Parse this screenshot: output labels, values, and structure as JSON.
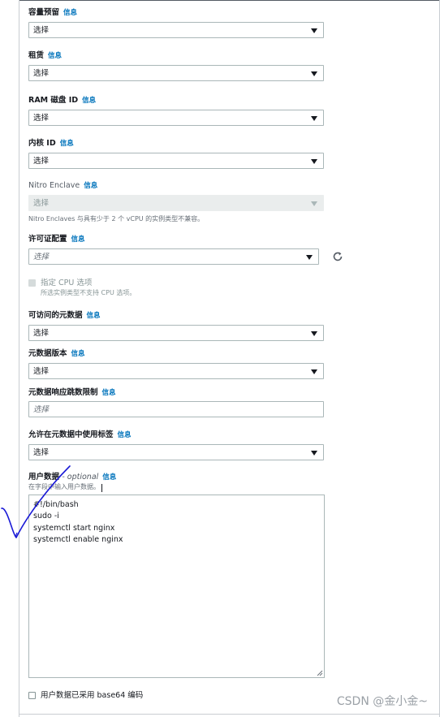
{
  "info_label": "信息",
  "fields": {
    "capacity_reservation": {
      "label": "容量预留",
      "value": "选择"
    },
    "tenancy": {
      "label": "租赁",
      "value": "选择"
    },
    "ramdisk_id": {
      "label": "RAM 磁盘 ID",
      "value": "选择"
    },
    "kernel_id": {
      "label": "内核 ID",
      "value": "选择"
    },
    "nitro_enclave": {
      "label": "Nitro Enclave",
      "value": "选择",
      "description": "Nitro Enclaves 与具有少于 2 个 vCPU 的实例类型不兼容。"
    },
    "license_config": {
      "label": "许可证配置",
      "placeholder": "选择"
    },
    "specify_cpu": {
      "label": "指定 CPU 选项",
      "description": "所选实例类型不支持 CPU 选项。",
      "checked": false
    },
    "metadata_accessible": {
      "label": "可访问的元数据",
      "value": "选择"
    },
    "metadata_version": {
      "label": "元数据版本",
      "value": "选择"
    },
    "metadata_hop_limit": {
      "label": "元数据响应跳数限制",
      "placeholder": "选择"
    },
    "allow_tags_in_metadata": {
      "label": "允许在元数据中使用标签",
      "value": "选择"
    },
    "user_data": {
      "label": "用户数据",
      "optional": "- optional",
      "hint": "在字段中输入用户数据。",
      "lines": [
        "#!/bin/bash",
        "sudo -i",
        "systemctl start nginx",
        "systemctl enable nginx"
      ]
    },
    "base64_encoded": {
      "label": "用户数据已采用 base64 编码",
      "checked": false
    }
  },
  "watermark": "CSDN @金小金~",
  "colors": {
    "link": "#0073bb",
    "border": "#aab7b8",
    "pen": "#1a1ad6"
  }
}
